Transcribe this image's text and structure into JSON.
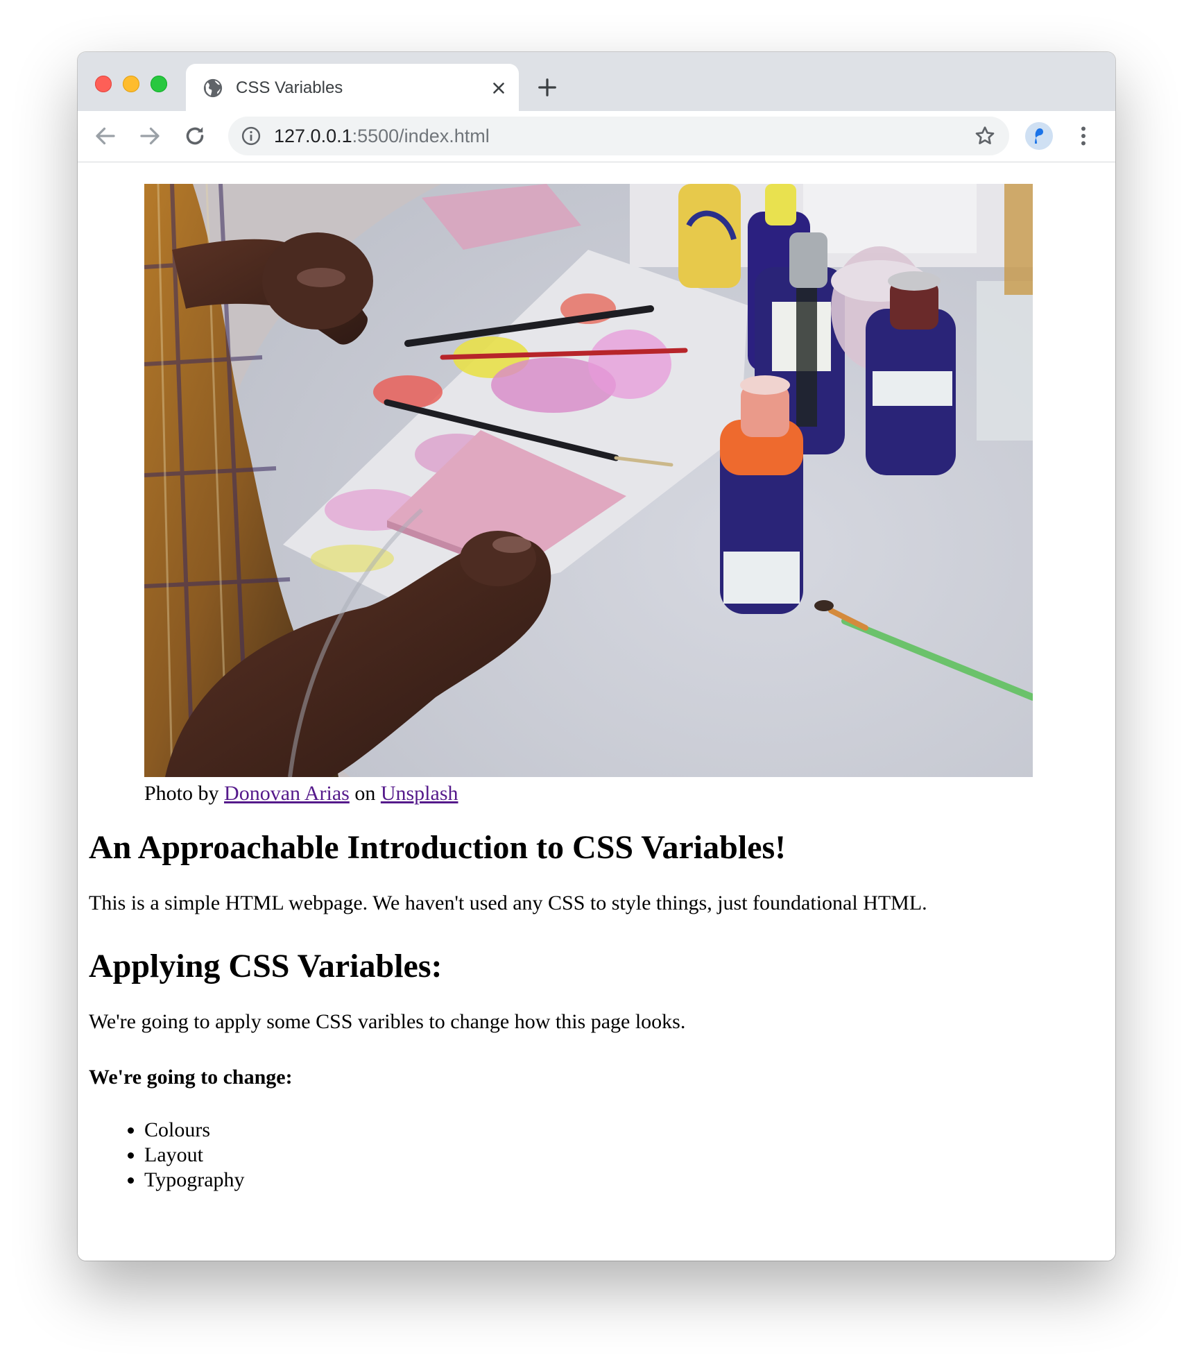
{
  "browser": {
    "tab": {
      "title": "CSS Variables",
      "icon": "globe-icon"
    },
    "new_tab_icon": "plus-icon",
    "address": {
      "host": "127.0.0.1",
      "rest": ":5500/index.html"
    },
    "icons": {
      "back": "arrow-left-icon",
      "forward": "arrow-right-icon",
      "reload": "reload-icon",
      "info": "info-icon",
      "bookmark": "star-icon",
      "profile": "avatar",
      "menu": "kebab-menu-icon"
    },
    "colors": {
      "tabstrip": "#dee1e6",
      "omnibox": "#f1f3f4",
      "traffic_red": "#fe5f57",
      "traffic_yellow": "#febc2e",
      "traffic_green": "#28c840"
    }
  },
  "page": {
    "caption": {
      "prefix": "Photo by ",
      "author": "Donovan Arias",
      "middle": " on ",
      "source": "Unsplash"
    },
    "heading1": "An Approachable Introduction to CSS Variables!",
    "paragraph1": "This is a simple HTML webpage. We haven't used any CSS to style things, just foundational HTML.",
    "heading2": "Applying CSS Variables:",
    "paragraph2": "We're going to apply some CSS varibles to change how this page looks.",
    "change_label": "We're going to change:",
    "list_items": [
      "Colours",
      "Layout",
      "Typography"
    ],
    "link_color": "#551a8b"
  }
}
